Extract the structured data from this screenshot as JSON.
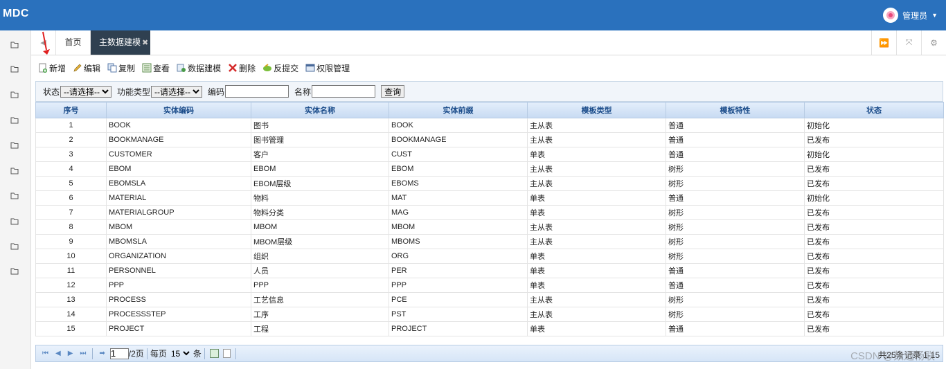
{
  "header": {
    "logo": "MDC",
    "user": "管理员"
  },
  "tabs": {
    "home": "首页",
    "active": "主数据建模"
  },
  "toolbar": [
    {
      "label": "新增",
      "icon": "add-doc-icon"
    },
    {
      "label": "编辑",
      "icon": "pencil-icon"
    },
    {
      "label": "复制",
      "icon": "copy-icon"
    },
    {
      "label": "查看",
      "icon": "view-icon"
    },
    {
      "label": "数据建模",
      "icon": "model-icon"
    },
    {
      "label": "删除",
      "icon": "delete-x-icon"
    },
    {
      "label": "反提交",
      "icon": "revert-icon"
    },
    {
      "label": "权限管理",
      "icon": "permission-icon"
    }
  ],
  "search": {
    "status_label": "状态",
    "status_value": "--请选择--",
    "func_label": "功能类型",
    "func_value": "--请选择--",
    "code_label": "编码",
    "code_value": "",
    "name_label": "名称",
    "name_value": "",
    "query_button": "查询"
  },
  "table": {
    "columns": [
      "序号",
      "实体编码",
      "实体名称",
      "实体前缀",
      "模板类型",
      "模板特性",
      "状态"
    ],
    "rows": [
      [
        "1",
        "BOOK",
        "图书",
        "BOOK",
        "主从表",
        "普通",
        "初始化"
      ],
      [
        "2",
        "BOOKMANAGE",
        "图书管理",
        "BOOKMANAGE",
        "主从表",
        "普通",
        "已发布"
      ],
      [
        "3",
        "CUSTOMER",
        "客户",
        "CUST",
        "单表",
        "普通",
        "初始化"
      ],
      [
        "4",
        "EBOM",
        "EBOM",
        "EBOM",
        "主从表",
        "树形",
        "已发布"
      ],
      [
        "5",
        "EBOMSLA",
        "EBOM层级",
        "EBOMS",
        "主从表",
        "树形",
        "已发布"
      ],
      [
        "6",
        "MATERIAL",
        "物料",
        "MAT",
        "单表",
        "普通",
        "初始化"
      ],
      [
        "7",
        "MATERIALGROUP",
        "物料分类",
        "MAG",
        "单表",
        "树形",
        "已发布"
      ],
      [
        "8",
        "MBOM",
        "MBOM",
        "MBOM",
        "主从表",
        "树形",
        "已发布"
      ],
      [
        "9",
        "MBOMSLA",
        "MBOM层级",
        "MBOMS",
        "主从表",
        "树形",
        "已发布"
      ],
      [
        "10",
        "ORGANIZATION",
        "组织",
        "ORG",
        "单表",
        "树形",
        "已发布"
      ],
      [
        "11",
        "PERSONNEL",
        "人员",
        "PER",
        "单表",
        "普通",
        "已发布"
      ],
      [
        "12",
        "PPP",
        "PPP",
        "PPP",
        "单表",
        "普通",
        "已发布"
      ],
      [
        "13",
        "PROCESS",
        "工艺信息",
        "PCE",
        "主从表",
        "树形",
        "已发布"
      ],
      [
        "14",
        "PROCESSSTEP",
        "工序",
        "PST",
        "主从表",
        "树形",
        "已发布"
      ],
      [
        "15",
        "PROJECT",
        "工程",
        "PROJECT",
        "单表",
        "普通",
        "已发布"
      ]
    ]
  },
  "pager": {
    "page": "1",
    "total_pages": "/2页",
    "per_page_label": "每页",
    "per_page_value": "15",
    "unit": "条",
    "total": "共25条记录 1-15"
  },
  "watermark": "CSDN @数通畅联"
}
